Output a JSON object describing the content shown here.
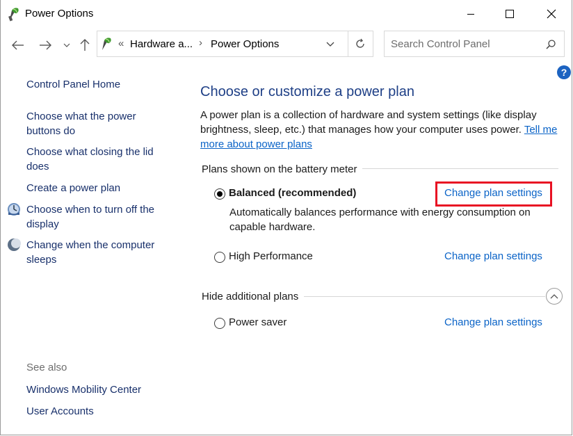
{
  "window": {
    "title": "Power Options"
  },
  "address_bar": {
    "overflow_glyph": "«",
    "segment1": "Hardware a...",
    "separator": "›",
    "segment2": "Power Options"
  },
  "search": {
    "placeholder": "Search Control Panel"
  },
  "help_glyph": "?",
  "sidebar": {
    "home": "Control Panel Home",
    "link1": "Choose what the power buttons do",
    "link2": "Choose what closing the lid does",
    "link3": "Create a power plan",
    "link4": "Choose when to turn off the display",
    "link5": "Change when the computer sleeps",
    "see_also": "See also",
    "mobility": "Windows Mobility Center",
    "accounts": "User Accounts"
  },
  "main": {
    "heading": "Choose or customize a power plan",
    "description": "A power plan is a collection of hardware and system settings (like display brightness, sleep, etc.) that manages how your computer uses power.",
    "learn_more": "Tell me more about power plans",
    "section_battery": "Plans shown on the battery meter",
    "section_hide": "Hide additional plans",
    "plans": [
      {
        "name": "Balanced (recommended)",
        "selected": true,
        "description": "Automatically balances performance with energy consumption on capable hardware.",
        "link": "Change plan settings"
      },
      {
        "name": "High Performance",
        "selected": false,
        "link": "Change plan settings"
      },
      {
        "name": "Power saver",
        "selected": false,
        "link": "Change plan settings"
      }
    ]
  },
  "colors": {
    "link": "#0a63c7",
    "nav_link": "#18306b",
    "heading": "#1e3f86",
    "highlight": "#e81123",
    "help": "#1c63c1"
  }
}
